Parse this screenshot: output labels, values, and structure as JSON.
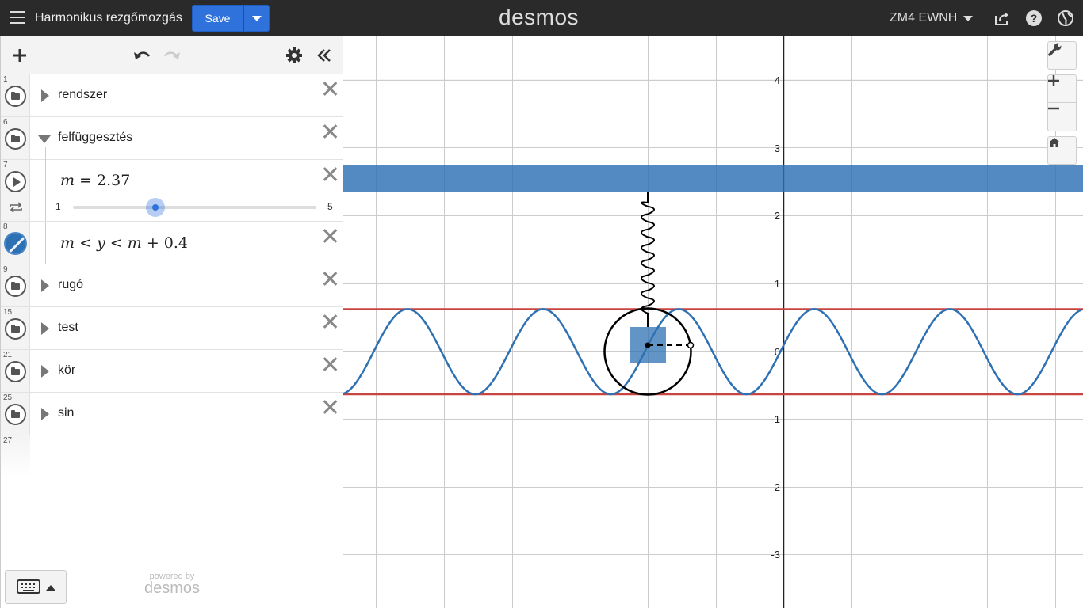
{
  "header": {
    "graph_title": "Harmonikus rezgőmozgás",
    "save_label": "Save",
    "logo": "desmos",
    "user_name": "ZM4 EWNH",
    "icons": [
      "hamburger-icon",
      "share-icon",
      "help-icon",
      "globe-icon"
    ]
  },
  "toolbar": {
    "icons": [
      "add-icon",
      "undo-icon",
      "redo-icon",
      "settings-icon",
      "collapse-icon"
    ]
  },
  "expressions": [
    {
      "num": "1",
      "type": "folder",
      "label": "rendszer",
      "collapsed": true
    },
    {
      "num": "6",
      "type": "folder",
      "label": "felfüggesztés",
      "collapsed": false
    },
    {
      "num": "7",
      "type": "slider",
      "var": "m",
      "value": "2.37",
      "min": "1",
      "max": "5",
      "fraction": 0.3425
    },
    {
      "num": "8",
      "type": "inequality",
      "color": "#2d70b3"
    },
    {
      "num": "9",
      "type": "folder",
      "label": "rugó",
      "collapsed": true
    },
    {
      "num": "15",
      "type": "folder",
      "label": "test",
      "collapsed": true
    },
    {
      "num": "21",
      "type": "folder",
      "label": "kör",
      "collapsed": true
    },
    {
      "num": "25",
      "type": "folder",
      "label": "sin",
      "collapsed": true
    },
    {
      "num": "27",
      "type": "empty"
    }
  ],
  "inequality_parts": {
    "a": "m",
    "lt1": " < ",
    "b": "y",
    "lt2": " < ",
    "c": "m",
    "plus": " + ",
    "d": "0.4"
  },
  "powered": {
    "by": "powered by",
    "logo": "desmos"
  },
  "graph": {
    "y_ticks": [
      "4",
      "3",
      "2",
      "1",
      "0",
      "-1",
      "-2",
      "-3"
    ],
    "colors": {
      "blue": "#2d70b3",
      "red": "#c74440",
      "black": "#000000"
    },
    "controls": [
      "wrench-icon",
      "zoom-in-icon",
      "zoom-out-icon",
      "home-icon"
    ]
  }
}
